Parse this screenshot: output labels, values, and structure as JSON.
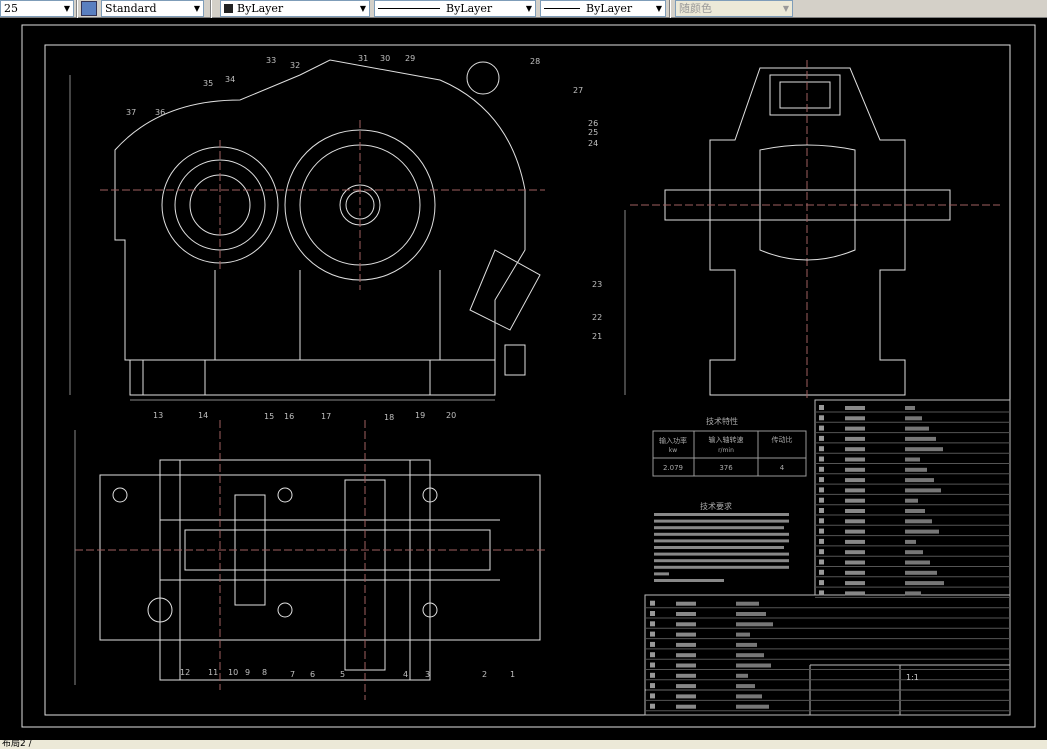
{
  "toolbar": {
    "dimstyle_value": "25",
    "textstyle_value": "Standard",
    "color_value": "ByLayer",
    "linetype_value": "ByLayer",
    "lineweight_value": "ByLayer",
    "plotstyle_value": "随颜色"
  },
  "drawing": {
    "callouts_top": [
      "33",
      "32",
      "31",
      "30",
      "29",
      "28",
      "27",
      "26",
      "25",
      "24",
      "23",
      "22",
      "21",
      "35",
      "34",
      "37",
      "36"
    ],
    "callouts_bottom_top": [
      "13",
      "14",
      "15",
      "16",
      "17",
      "18",
      "19",
      "20"
    ],
    "callouts_bottom_low": [
      "12",
      "11",
      "10",
      "9",
      "8",
      "7",
      "6",
      "5",
      "4",
      "3",
      "2",
      "1"
    ],
    "spec_table": {
      "title": "技术特性",
      "headers": [
        "输入功率",
        "输入轴转速",
        "传动比"
      ],
      "units": [
        "kw",
        "r/min",
        ""
      ],
      "values": [
        "2.079",
        "376",
        "4"
      ]
    },
    "requirements_title": "技术要求",
    "scale": "1:1"
  },
  "layout_tab": "布局2",
  "colors": {
    "background": "#000000",
    "lines": "#e0e0e0",
    "callout": "#c0c0c0"
  }
}
